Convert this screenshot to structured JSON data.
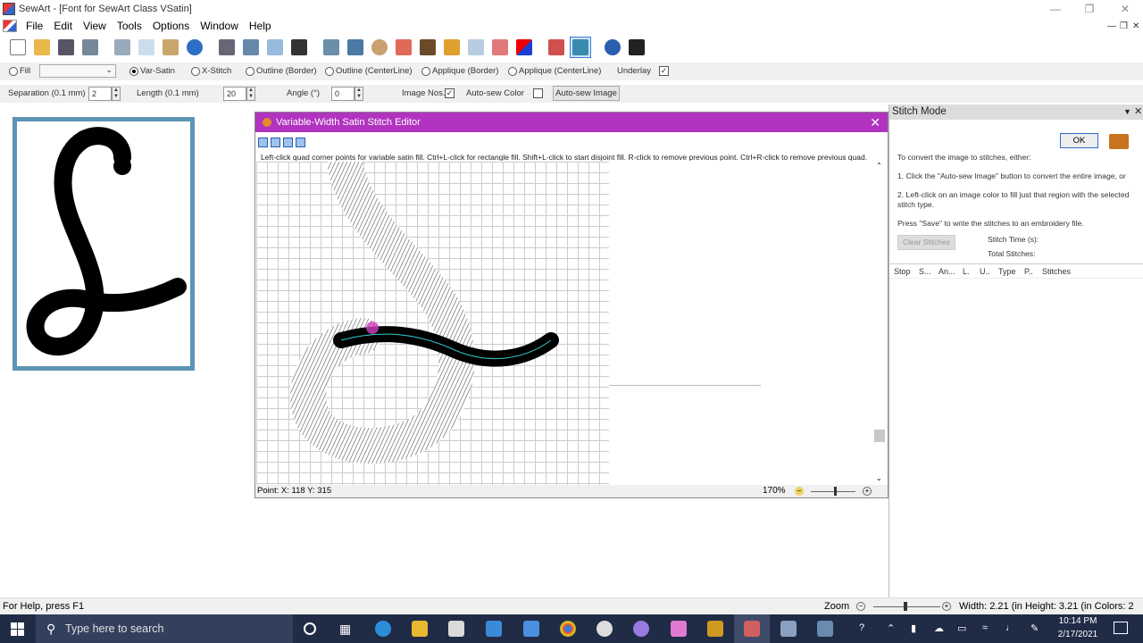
{
  "window": {
    "title": "SewArt - [Font for SewArt Class VSatin]"
  },
  "menu": [
    "File",
    "Edit",
    "View",
    "Tools",
    "Options",
    "Window",
    "Help"
  ],
  "toolbar_icons": [
    "new-icon",
    "open-icon",
    "save-icon",
    "save-as-icon",
    "cut-icon",
    "copy-icon",
    "paste-icon",
    "undo-icon",
    "flip-icon",
    "rotate-icon",
    "resize-icon",
    "crop-icon",
    "magic-wand-icon",
    "merge-icon",
    "color-reduce-icon",
    "lines-icon",
    "pencil-icon",
    "brush-icon",
    "fill-icon",
    "eraser-icon",
    "color-swap-icon",
    "stitch-icon",
    "sew-icon",
    "help-icon",
    "whats-this-icon"
  ],
  "options": {
    "fill": "Fill",
    "var_satin": "Var-Satin",
    "x_stitch": "X-Stitch",
    "outline_border": "Outline (Border)",
    "outline_center": "Outline (CenterLine)",
    "applique_border": "Applique (Border)",
    "applique_center": "Applique (CenterLine)",
    "underlay": "Underlay",
    "selected": "var_satin"
  },
  "params": {
    "separation_label": "Separation (0.1 mm)",
    "separation_value": "2",
    "length_label": "Length (0.1 mm)",
    "length_value": "20",
    "angle_label": "Angle (°)",
    "angle_value": "0",
    "image_nos": "Image Nos.",
    "auto_sew_color": "Auto-sew Color",
    "auto_sew_image": "Auto-sew Image"
  },
  "editor": {
    "title": "Variable-Width Satin Stitch Editor",
    "instructions": "Left-click quad corner points for variable satin fill. Ctrl+L-click for rectangle fill. Shift+L-click to start disjoint fill. R-click to remove previous point. Ctrl+R-click to remove previous quad.",
    "point": "Point: X: 118 Y: 315",
    "zoom": "170%"
  },
  "stitch_mode": {
    "header": "Stitch Mode",
    "ok": "OK",
    "intro": "To convert the image to stitches, either:",
    "step1": "1. Click the \"Auto-sew Image\" button to convert the entire image, or",
    "step2": "2. Left-click on an image color to fill just that region with the selected stitch type.",
    "save_hint": "Press \"Save\" to write the stitches to an embroidery file.",
    "clear": "Clear Stitches",
    "stitch_time": "Stitch Time (s):",
    "total_stitches": "Total Stitches:",
    "columns": [
      "Stop",
      "S...",
      "An...",
      "L.",
      "U..",
      "Type",
      "P..",
      "Stitches"
    ]
  },
  "status": {
    "help": "For Help, press F1",
    "zoom_label": "Zoom",
    "info": "Width: 2.21 (in Height: 3.21 (in Colors: 2"
  },
  "taskbar": {
    "search": "Type here to search",
    "time": "10:14 PM",
    "date": "2/17/2021"
  }
}
